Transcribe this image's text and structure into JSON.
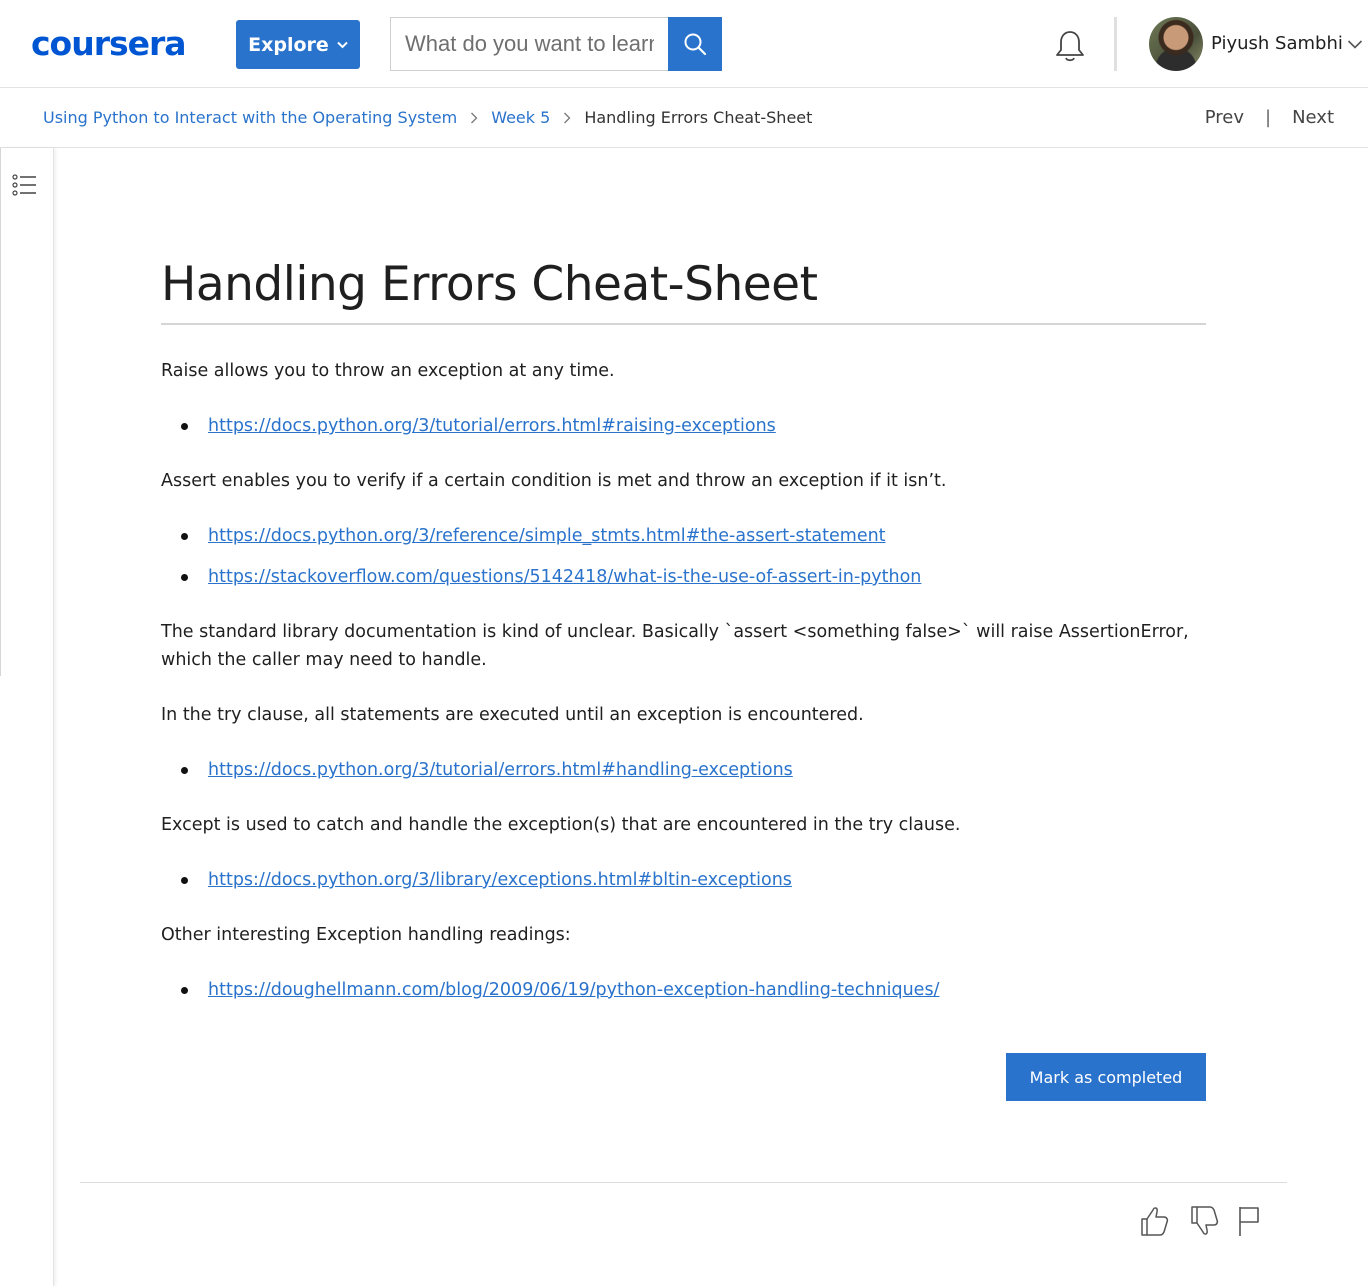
{
  "header": {
    "logo_text": "coursera",
    "explore_label": "Explore",
    "search": {
      "placeholder": "What do you want to learn?",
      "value": ""
    },
    "user_name": "Piyush Sambhi",
    "brand_color": "#2a73cc",
    "icons": [
      "search-icon",
      "bell-icon",
      "chevron-down-icon"
    ]
  },
  "breadcrumb": {
    "items": [
      "Using Python to Interact with the Operating System",
      "Week 5",
      "Handling Errors Cheat-Sheet"
    ],
    "prev_label": "Prev",
    "separator": "|",
    "next_label": "Next"
  },
  "main": {
    "title": "Handling Errors Cheat-Sheet",
    "blocks": [
      {
        "type": "p",
        "text": "Raise allows you to throw an exception at any time."
      },
      {
        "type": "link",
        "text": "https://docs.python.org/3/tutorial/errors.html#raising-exceptions"
      },
      {
        "type": "p",
        "text": "Assert enables you to verify if a certain condition is met and throw an exception if it isn’t."
      },
      {
        "type": "link",
        "text": "https://docs.python.org/3/reference/simple_stmts.html#the-assert-statement"
      },
      {
        "type": "link",
        "text": "https://stackoverflow.com/questions/5142418/what-is-the-use-of-assert-in-python"
      },
      {
        "type": "p",
        "text": "The standard library documentation is kind of unclear. Basically `assert <something false>` will raise AssertionError, which the caller may need to handle."
      },
      {
        "type": "p",
        "text": "In the try clause, all statements are executed until an exception is encountered."
      },
      {
        "type": "link",
        "text": "https://docs.python.org/3/tutorial/errors.html#handling-exceptions"
      },
      {
        "type": "p",
        "text": "Except is used to catch and handle the exception(s) that are encountered in the try clause."
      },
      {
        "type": "link",
        "text": "https://docs.python.org/3/library/exceptions.html#bltin-exceptions"
      },
      {
        "type": "p",
        "text": "Other interesting Exception handling readings:"
      },
      {
        "type": "link",
        "text": "https://doughellmann.com/blog/2009/06/19/python-exception-handling-techniques/"
      }
    ],
    "mark_completed_label": "Mark as completed"
  },
  "feedback": {
    "icons": [
      "thumbs-up-icon",
      "thumbs-down-icon",
      "flag-icon"
    ]
  }
}
